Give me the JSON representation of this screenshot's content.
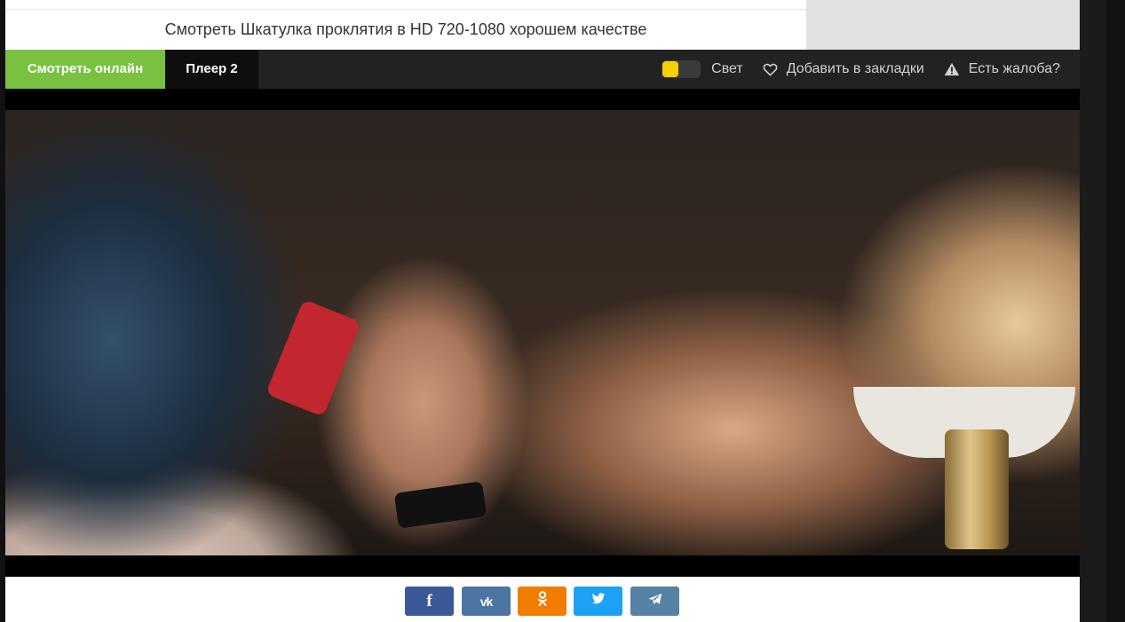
{
  "header": {
    "title": "Смотреть Шкатулка проклятия в HD 720-1080 хорошем качестве"
  },
  "player_tabs": [
    {
      "label": "Смотреть онлайн",
      "active": true,
      "color": "#7ac142"
    },
    {
      "label": "Плеер 2",
      "active": false
    }
  ],
  "controls": {
    "light_label": "Свет",
    "light_toggle_color": "#f5d000",
    "bookmark_label": "Добавить в закладки",
    "bookmark_icon": "heart-icon",
    "complaint_label": "Есть жалоба?",
    "complaint_icon": "warning-icon"
  },
  "share": [
    {
      "network": "facebook",
      "icon": "facebook-icon",
      "glyph": "f",
      "color": "#3b5998"
    },
    {
      "network": "vkontakte",
      "icon": "vk-icon",
      "glyph": "vk",
      "color": "#4c75a3"
    },
    {
      "network": "odnoklassniki",
      "icon": "odnoklassniki-icon",
      "glyph": "ok",
      "color": "#f07c00"
    },
    {
      "network": "twitter",
      "icon": "twitter-icon",
      "glyph": "t",
      "color": "#1da1f2"
    },
    {
      "network": "telegram",
      "icon": "telegram-icon",
      "glyph": "tg",
      "color": "#5682a3"
    }
  ]
}
